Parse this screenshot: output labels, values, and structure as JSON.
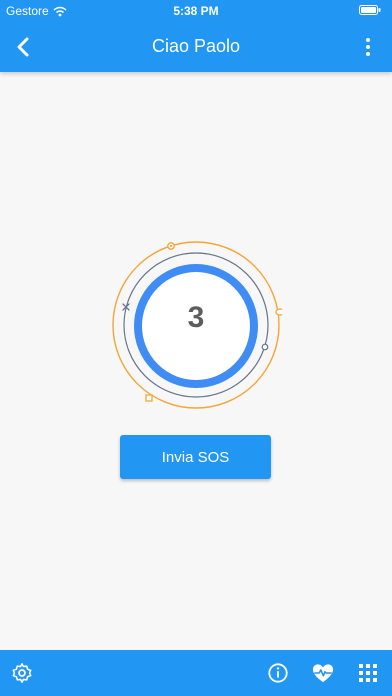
{
  "status_bar": {
    "carrier": "Gestore",
    "time": "5:38 PM"
  },
  "header": {
    "title": "Ciao Paolo"
  },
  "main": {
    "countdown": "3",
    "sos_button_label": "Invia SOS"
  },
  "icons": {
    "back": "chevron-left-icon",
    "menu": "more-vertical-icon",
    "settings": "gear-icon",
    "info": "info-icon",
    "health": "heart-pulse-icon",
    "apps": "grid-icon"
  },
  "colors": {
    "primary": "#2196f3",
    "background": "#f7f7f7",
    "orbit": "#f4a534",
    "outline": "#66758a"
  }
}
